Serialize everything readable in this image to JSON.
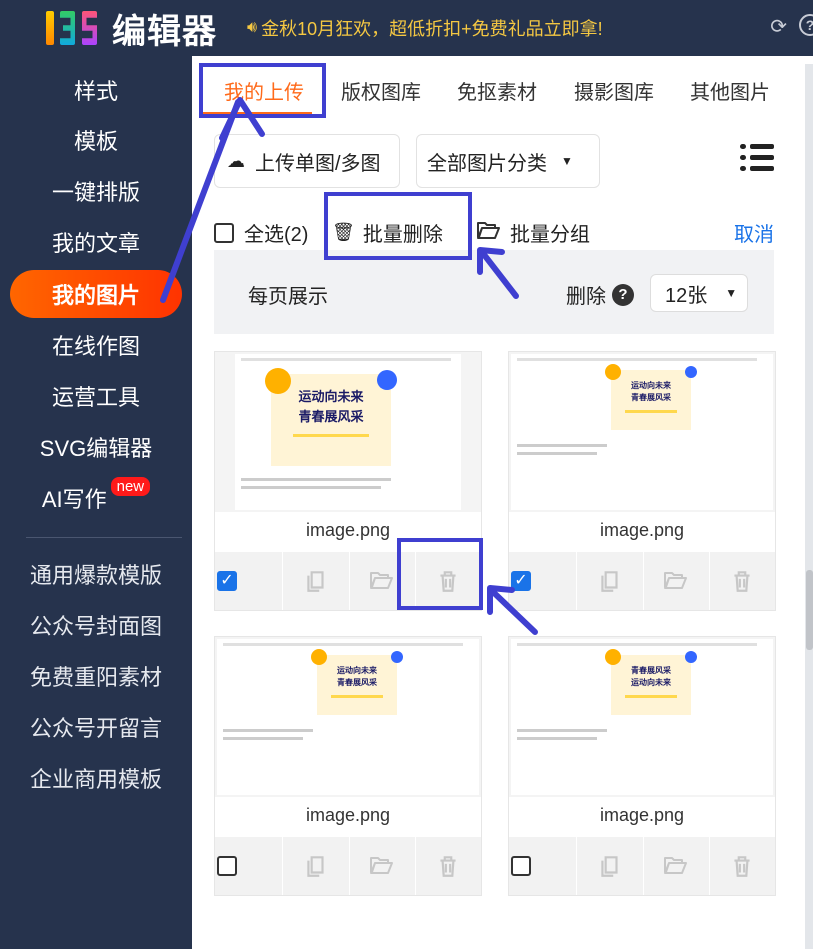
{
  "header": {
    "logo_text": "编辑器",
    "announcement": "金秋10月狂欢，超低折扣+免费礼品立即拿!"
  },
  "sidebar": {
    "items": [
      {
        "label": "样式"
      },
      {
        "label": "模板"
      },
      {
        "label": "一键排版"
      },
      {
        "label": "我的文章"
      },
      {
        "label": "我的图片"
      },
      {
        "label": "在线作图"
      },
      {
        "label": "运营工具"
      },
      {
        "label": "SVG编辑器"
      },
      {
        "label": "AI写作",
        "badge": "new"
      }
    ],
    "secondary": [
      {
        "label": "通用爆款模版"
      },
      {
        "label": "公众号封面图"
      },
      {
        "label": "免费重阳素材"
      },
      {
        "label": "公众号开留言"
      },
      {
        "label": "企业商用模板"
      }
    ]
  },
  "tabs": [
    {
      "label": "我的上传"
    },
    {
      "label": "版权图库"
    },
    {
      "label": "免抠素材"
    },
    {
      "label": "摄影图库"
    },
    {
      "label": "其他图片"
    }
  ],
  "toolbar": {
    "upload_label": "上传单图/多图",
    "category_label": "全部图片分类"
  },
  "bulk": {
    "select_all_label": "全选(2)",
    "bulk_delete_label": "批量删除",
    "bulk_group_label": "批量分组",
    "cancel_label": "取消"
  },
  "perpage": {
    "label": "每页展示",
    "delete_label": "删除",
    "help": "?",
    "value": "12张"
  },
  "images": [
    {
      "name": "image.png",
      "checked": true,
      "poster_title_1": "运动向未来",
      "poster_title_2": "青春展风采"
    },
    {
      "name": "image.png",
      "checked": true,
      "poster_title_1": "运动向未来",
      "poster_title_2": "青春展风采"
    },
    {
      "name": "image.png",
      "checked": false,
      "poster_title_1": "运动向未来",
      "poster_title_2": "青春展风采"
    },
    {
      "name": "image.png",
      "checked": false,
      "poster_title_1": "青春展风采",
      "poster_title_2": "运动向未来"
    }
  ],
  "colors": {
    "sidebar_bg": "#26334d",
    "accent_orange": "#ff6a1a",
    "link_blue": "#1a73e8",
    "annotation_blue": "#3f3fd0"
  }
}
